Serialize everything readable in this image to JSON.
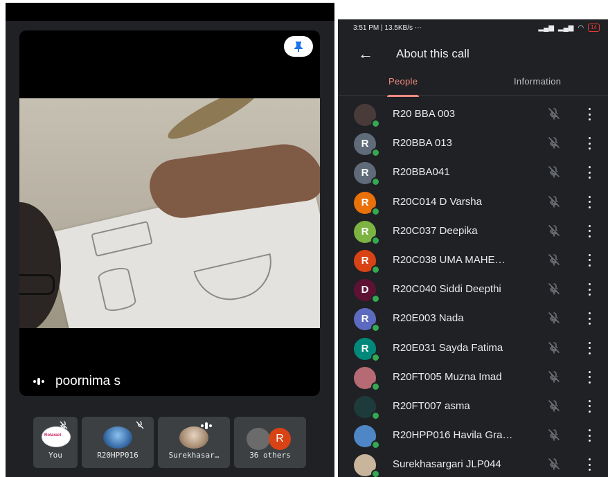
{
  "left": {
    "speaker_name": "poornima s",
    "thumbnails": [
      {
        "label": "You",
        "logo_text": "Rotaract"
      },
      {
        "label": "R20HPP016"
      },
      {
        "label": "Surekhasar…"
      },
      {
        "label": "36 others",
        "avatar_letter": "R"
      }
    ]
  },
  "right": {
    "status": {
      "time": "3:51 PM",
      "speed": "13.5KB/s",
      "extra": "⋯",
      "battery": "14"
    },
    "title": "About this call",
    "tabs": [
      "People",
      "Information"
    ],
    "participants": [
      {
        "name": "R20 BBA 003",
        "letter": "",
        "color": "#4a3b3b"
      },
      {
        "name": "R20BBA 013",
        "letter": "R",
        "color": "#5f6b78"
      },
      {
        "name": "R20BBA041",
        "letter": "R",
        "color": "#5f6b78"
      },
      {
        "name": "R20C014 D Varsha",
        "letter": "R",
        "color": "#e8710a"
      },
      {
        "name": "R20C037 Deepika",
        "letter": "R",
        "color": "#7cb342"
      },
      {
        "name": "R20C038 UMA MAHE…",
        "letter": "R",
        "color": "#d84315"
      },
      {
        "name": "R20C040 Siddi Deepthi",
        "letter": "D",
        "color": "#5e1233"
      },
      {
        "name": "R20E003 Nada",
        "letter": "R",
        "color": "#5c6bc0"
      },
      {
        "name": "R20E031 Sayda Fatima",
        "letter": "R",
        "color": "#00897b"
      },
      {
        "name": "R20FT005 Muzna Imad",
        "letter": "",
        "color": "#b56a74"
      },
      {
        "name": "R20FT007 asma",
        "letter": "",
        "color": "#1e3b3b"
      },
      {
        "name": "R20HPP016 Havila Gra…",
        "letter": "",
        "color": "#4f86c6"
      },
      {
        "name": "Surekhasargari JLP044",
        "letter": "",
        "color": "#c9b49c"
      }
    ]
  }
}
